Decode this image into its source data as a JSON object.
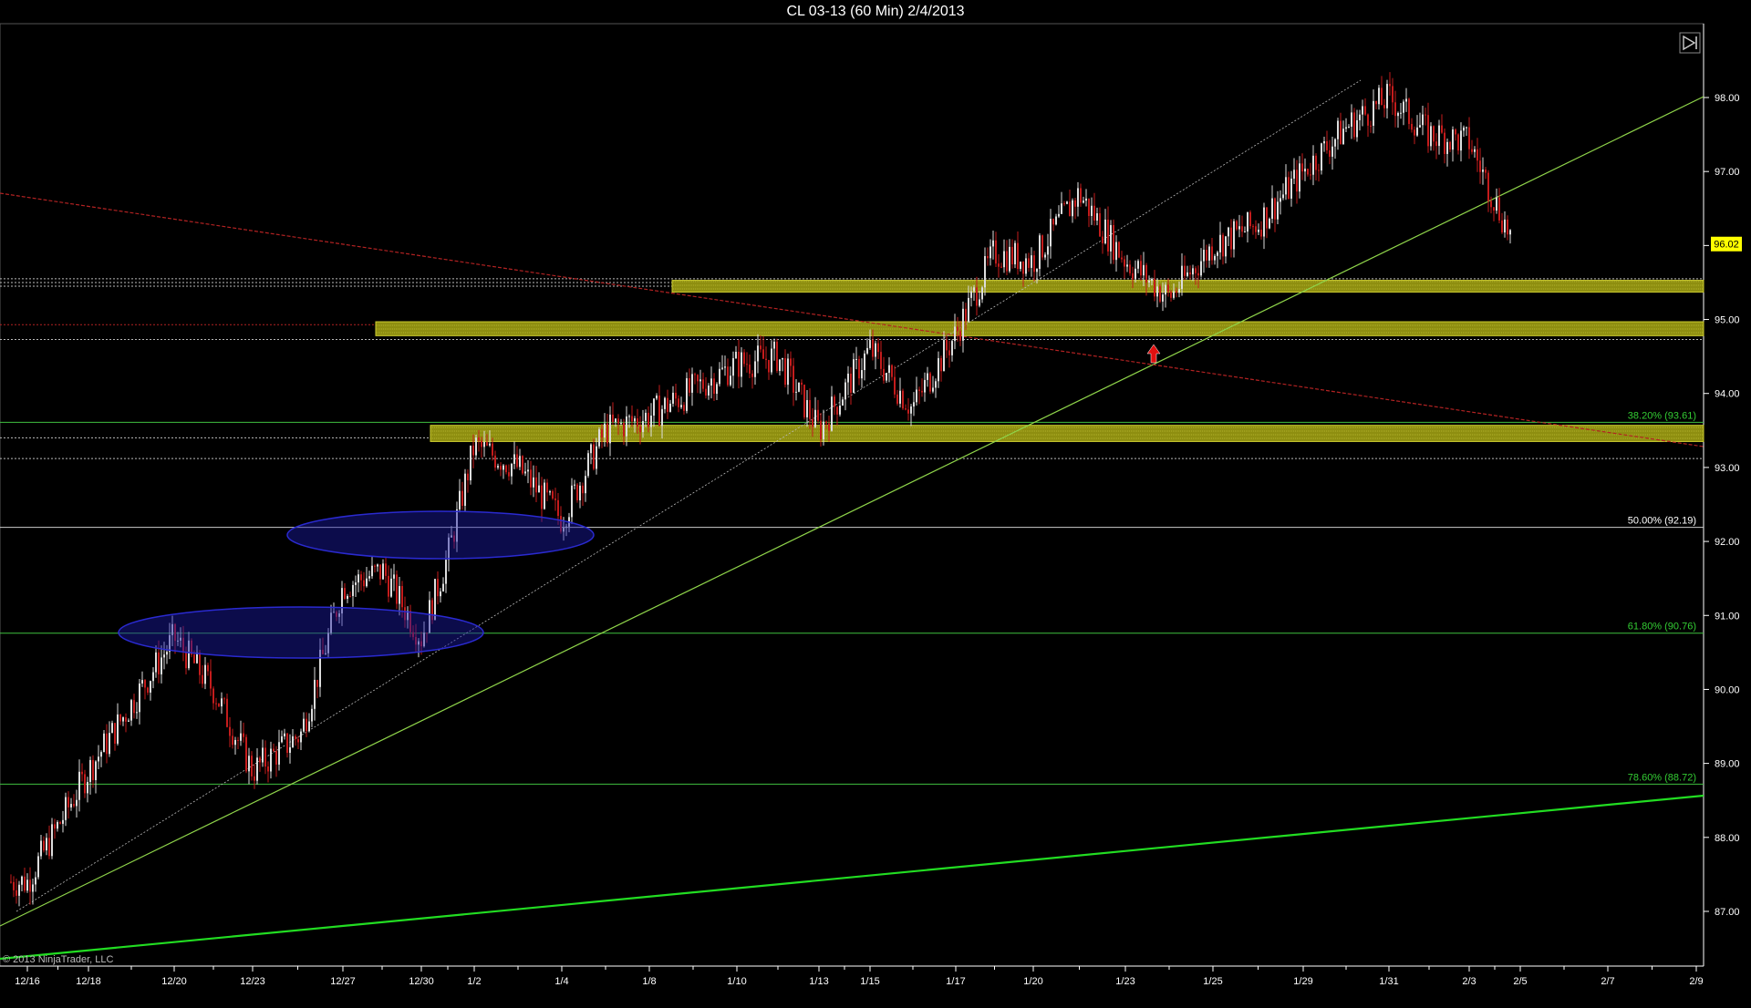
{
  "window": {
    "title": "CL 03-13 (60 Min)  2/4/2013"
  },
  "copyright": "© 2013 NinjaTrader, LLC",
  "colors": {
    "background": "#000000",
    "axis": "#ffffff",
    "bar_up": "#dddddd",
    "bar_down": "#c41c1c",
    "zone_fill": "#9a9a12",
    "trend_green": "#7ed321",
    "long_trend": "#22dd22",
    "resistance": "#b22222",
    "ellipse": "#1a1aa6",
    "fib_label": "#33cc33",
    "price_badge": "#ffff00"
  },
  "icons": {
    "scroll_end": "skip-to-end-icon",
    "signal": "red-up-arrow-icon"
  },
  "chart_data": {
    "type": "candlestick",
    "x_ticks": [
      "12/16",
      "12/18",
      "12/20",
      "12/23",
      "12/27",
      "12/30",
      "1/2",
      "1/4",
      "1/8",
      "1/10",
      "1/13",
      "1/15",
      "1/17",
      "1/20",
      "1/23",
      "1/25",
      "1/29",
      "1/31",
      "2/3",
      "2/5",
      "2/7",
      "2/9"
    ],
    "y_ticks": [
      "87.00",
      "88.00",
      "89.00",
      "90.00",
      "91.00",
      "92.00",
      "93.00",
      "94.00",
      "95.00",
      "96.00",
      "97.00",
      "98.00"
    ],
    "ylim": [
      86.32,
      98.92
    ],
    "last_price": "96.02",
    "fib_levels": [
      {
        "label": "38.20% (93.61)",
        "value": 93.61
      },
      {
        "label": "50.00% (92.19)",
        "value": 92.19
      },
      {
        "label": "61.80% (90.76)",
        "value": 90.76
      },
      {
        "label": "78.60% (88.72)",
        "value": 88.72
      }
    ],
    "zones": [
      {
        "from": 95.42,
        "to": 95.48,
        "start_tick": "1/8"
      },
      {
        "from": 94.83,
        "to": 94.92,
        "start_tick": "12/27"
      },
      {
        "from": 93.4,
        "to": 93.52,
        "start_tick": "12/30"
      }
    ],
    "price_path": [
      [
        "12/16",
        87.4
      ],
      [
        "12/18",
        88.9
      ],
      [
        "12/20",
        90.7
      ],
      [
        "12/21",
        90.0
      ],
      [
        "12/23",
        88.9
      ],
      [
        "12/26",
        89.4
      ],
      [
        "12/27",
        91.4
      ],
      [
        "12/28",
        91.6
      ],
      [
        "12/30",
        90.7
      ],
      [
        "12/31",
        91.8
      ],
      [
        "1/2",
        93.3
      ],
      [
        "1/3",
        93.0
      ],
      [
        "1/4",
        92.3
      ],
      [
        "1/7",
        93.5
      ],
      [
        "1/8",
        93.7
      ],
      [
        "1/10",
        94.4
      ],
      [
        "1/11",
        94.5
      ],
      [
        "1/13",
        93.5
      ],
      [
        "1/15",
        94.6
      ],
      [
        "1/16",
        93.8
      ],
      [
        "1/17",
        94.8
      ],
      [
        "1/18",
        95.9
      ],
      [
        "1/20",
        95.8
      ],
      [
        "1/22",
        96.7
      ],
      [
        "1/23",
        95.8
      ],
      [
        "1/24",
        95.3
      ],
      [
        "1/25",
        96.0
      ],
      [
        "1/28",
        96.3
      ],
      [
        "1/29",
        97.0
      ],
      [
        "1/30",
        97.6
      ],
      [
        "1/31",
        98.0
      ],
      [
        "2/1",
        97.5
      ],
      [
        "2/3",
        97.4
      ],
      [
        "2/4",
        96.02
      ]
    ]
  }
}
